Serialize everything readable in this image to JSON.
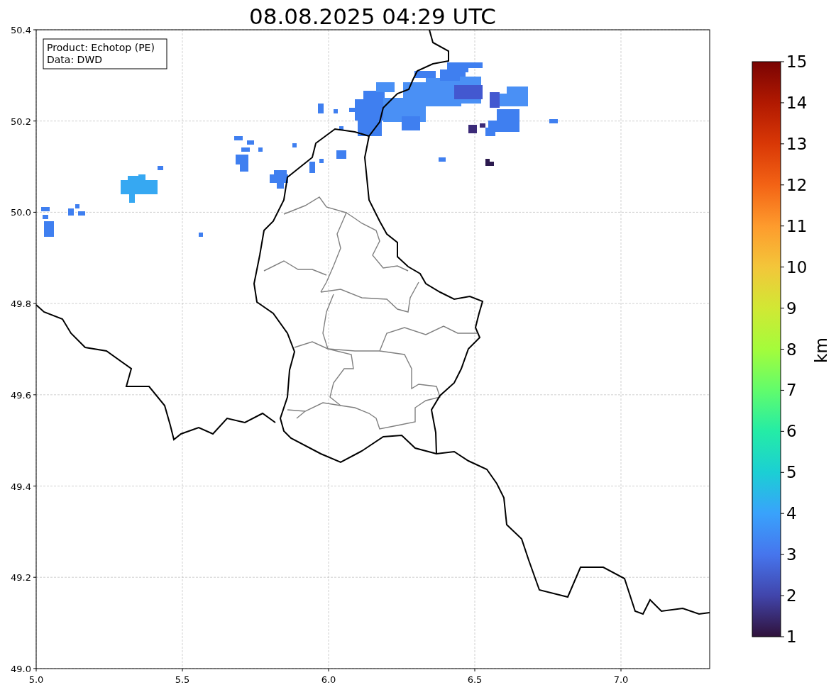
{
  "title": "08.08.2025 04:29 UTC",
  "info_box": {
    "lines": [
      "Product: Echotop (PE)",
      "Data: DWD"
    ]
  },
  "map": {
    "x_ticks": [
      "5.0",
      "5.5",
      "6.0",
      "6.5",
      "7.0"
    ],
    "y_ticks": [
      "50.4",
      "50.2",
      "50.0",
      "49.8",
      "49.6",
      "49.4",
      "49.2",
      "49.0"
    ]
  },
  "colorbar": {
    "label": "km",
    "ticks": [
      "15",
      "14",
      "13",
      "12",
      "11",
      "10",
      "9",
      "8",
      "7",
      "6",
      "5",
      "4",
      "3",
      "2",
      "1"
    ]
  }
}
